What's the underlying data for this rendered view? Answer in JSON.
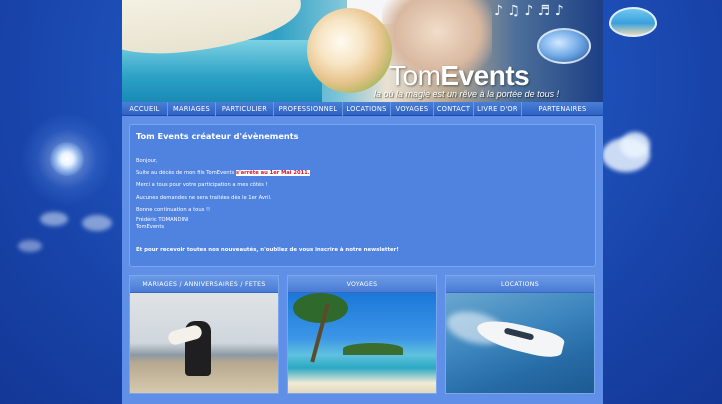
{
  "brand": {
    "name_part1": "Tom",
    "name_part2": "Events",
    "tagline": "la où la magie est un rêve à la portée de tous !"
  },
  "header": {
    "music_notes": "♪ ♫ ♪ ♬ ♪"
  },
  "nav": [
    {
      "label": "ACCUEIL"
    },
    {
      "label": "MARIAGES"
    },
    {
      "label": "PARTICULIER"
    },
    {
      "label": "PROFESSIONNEL"
    },
    {
      "label": "LOCATIONS"
    },
    {
      "label": "VOYAGES"
    },
    {
      "label": "CONTACT"
    },
    {
      "label": "LIVRE D'OR"
    },
    {
      "label": "PARTENAIRES"
    }
  ],
  "message": {
    "title": "Tom Events créateur d'évènements",
    "greeting": "Bonjour,",
    "line1_prefix": "Suite au décès de mon fils TomEvents",
    "line1_highlight": "s'arrête au 1er Mai 2011.",
    "line2": "Merci a tous pour votre participation a mes côtés !",
    "line3": "Aucunes demandes ne sera traitées dès le 1er Avril.",
    "line4": "Bonne continuation a tous !!",
    "signature_name": "Frédéric TOMANDINI",
    "signature_company": "TomEvents",
    "newsletter": "Et pour recevoir toutes nos nouveautés, n'oubliez de vous inscrire à notre newsletter!"
  },
  "panels": [
    {
      "label": "MARIAGES / ANNIVERSAIRES / FETES"
    },
    {
      "label": "VOYAGES"
    },
    {
      "label": "LOCATIONS"
    }
  ]
}
